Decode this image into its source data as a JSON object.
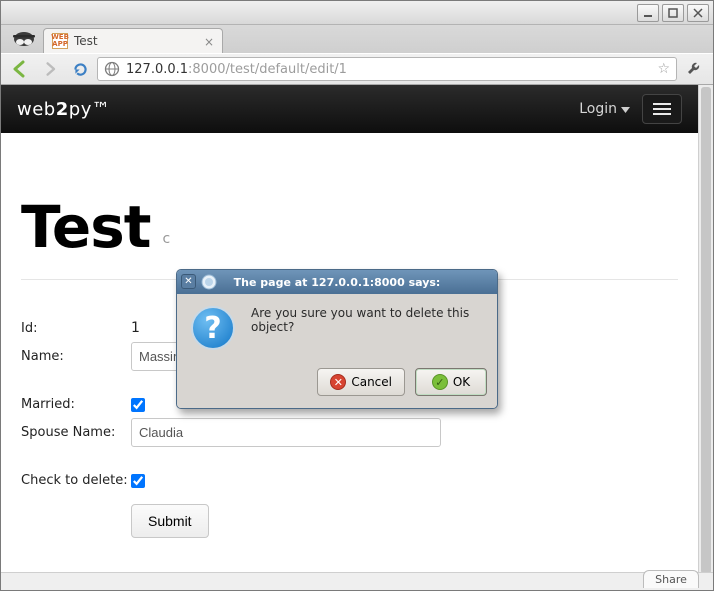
{
  "browser": {
    "tab_title": "Test",
    "favicon_text": "WEB\nAPP",
    "url_host": "127.0.0.1",
    "url_rest": ":8000/test/default/edit/1"
  },
  "brand": {
    "left": "web",
    "mid": "2",
    "right": "py",
    "tm": "™"
  },
  "nav": {
    "login_label": "Login"
  },
  "hero": {
    "title": "Test",
    "sub": "c"
  },
  "form": {
    "id_label": "Id:",
    "id_value": "1",
    "name_label": "Name:",
    "name_value": "Massimo",
    "married_label": "Married:",
    "married_checked": true,
    "spouse_label": "Spouse Name:",
    "spouse_value": "Claudia",
    "delete_label": "Check to delete:",
    "delete_checked": true,
    "submit_label": "Submit"
  },
  "dialog": {
    "title": "The page at 127.0.0.1:8000 says:",
    "message": "Are you sure you want to delete this object?",
    "cancel_label": "Cancel",
    "ok_label": "OK"
  },
  "footer": {
    "share_label": "Share"
  }
}
